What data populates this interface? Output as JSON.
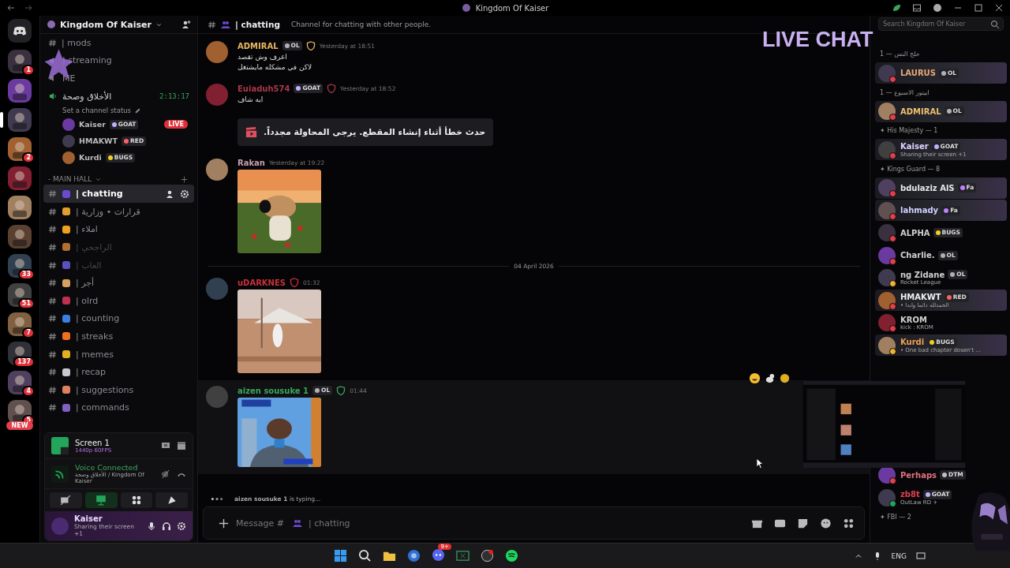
{
  "window": {
    "title": "Kingdom Of Kaiser"
  },
  "servers": [
    {
      "badge": "1",
      "selected": false
    },
    {
      "selected": false
    },
    {
      "selected": true
    },
    {
      "badge": "2",
      "selected": false
    },
    {
      "selected": false
    },
    {
      "selected": false
    },
    {
      "selected": false
    },
    {
      "badge": "33",
      "selected": false
    },
    {
      "badge": "51",
      "selected": false
    },
    {
      "badge": "7",
      "selected": false
    },
    {
      "badge": "137",
      "selected": false
    },
    {
      "badge": "4",
      "selected": false
    },
    {
      "badge": "5",
      "selected": false
    }
  ],
  "new_pill": "NEW",
  "sidebar": {
    "server_name": "Kingdom Of Kaiser",
    "channels_top": [
      {
        "kind": "text",
        "name": "| mods"
      },
      {
        "kind": "voice",
        "name": "| streaming"
      },
      {
        "kind": "voice",
        "name": "ME"
      }
    ],
    "voice_channel": {
      "name": "الأخلاق وصحة",
      "timer": "2:13:17",
      "status": "Set a channel status",
      "users": [
        {
          "name": "Kaiser",
          "tag": "GOAT",
          "badge": "LIVE"
        },
        {
          "name": "HMAKWT",
          "tag": "RED"
        },
        {
          "name": "Kurdi",
          "tag": "BUGS"
        }
      ]
    },
    "category": "- MAIN HALL",
    "channels": [
      {
        "name": "| chatting",
        "color": "#6c4ad0",
        "selected": true,
        "muted": false
      },
      {
        "name": "| قرارات • وزارية",
        "color": "#e0a030",
        "selected": false,
        "muted": false
      },
      {
        "name": "| املاء",
        "color": "#f0a020",
        "selected": false,
        "muted": false
      },
      {
        "name": "| الراجحي",
        "color": "#b07030",
        "selected": false,
        "muted": true
      },
      {
        "name": "| العاب",
        "color": "#5a50c0",
        "selected": false,
        "muted": true
      },
      {
        "name": "| أجر",
        "color": "#d8a060",
        "selected": false,
        "muted": false
      },
      {
        "name": "| olrd",
        "color": "#c03050",
        "selected": false,
        "muted": false
      },
      {
        "name": "| counting",
        "color": "#3a80e0",
        "selected": false,
        "muted": false
      },
      {
        "name": "| streaks",
        "color": "#f07020",
        "selected": false,
        "muted": false
      },
      {
        "name": "| memes",
        "color": "#e0b020",
        "selected": false,
        "muted": false
      },
      {
        "name": "| recap",
        "color": "#c8c8d0",
        "selected": false,
        "muted": false
      },
      {
        "name": "| suggestions",
        "color": "#e08060",
        "selected": false,
        "muted": false
      },
      {
        "name": "| commands",
        "color": "#8060c0",
        "selected": false,
        "muted": false
      }
    ],
    "stream": {
      "title": "Screen 1",
      "quality": "1440p 60FPS"
    },
    "voice": {
      "status": "Voice Connected",
      "location": "الأخلاق وصحة / Kingdom Of Kaiser",
      "screen_share_on": true
    },
    "user": {
      "name": "Kaiser",
      "activity": "Sharing their screen +1"
    }
  },
  "chat": {
    "channel": "| chatting",
    "topic": "Channel for chatting with other people.",
    "messages": [
      {
        "author": "ADMIRAL",
        "color": "#e8b860",
        "tags": [
          "OL"
        ],
        "shield": true,
        "time": "Yesterday at 18:51",
        "lines": [
          "اعرف وش تقصد",
          "لاكن في مشكله مايشتغل"
        ],
        "hovered": false
      },
      {
        "author": "Euiaduh574",
        "color": "#a83848",
        "tags": [
          "GOAT"
        ],
        "shield": true,
        "time": "Yesterday at 18:52",
        "lines": [
          "ايه شاف"
        ],
        "error": "حدث خطأ أثناء إنشاء المقطع. يرجى المحاولة مجدداً.",
        "hovered": false
      },
      {
        "author": "Rakan",
        "color": "#c8a0b0",
        "shield": false,
        "time": "Yesterday at 19:22",
        "attachment": {
          "kind": "picture"
        },
        "hovered": false
      },
      {
        "kind": "divider",
        "label": "04 April 2026"
      },
      {
        "author": "uDARKNES",
        "color": "#c8303a",
        "shield": true,
        "time": "01:32",
        "attachment": {
          "kind": "picture"
        },
        "hovered": false
      },
      {
        "author": "aizen sousuke 1",
        "color": "#3ba55c",
        "tags": [
          "OL"
        ],
        "shield": true,
        "time": "01:44",
        "attachment": {
          "kind": "picture"
        },
        "hovered": true
      }
    ],
    "typing": "**aizen sousuke 1** is typing...",
    "input": {
      "placeholder": "Message #",
      "channel": "| chatting"
    }
  },
  "members": {
    "search_placeholder": "Search Kingdom Of Kaiser",
    "groups": [
      {
        "label": "حلج النس — 1",
        "members": [
          {
            "name": {
              "text": "LAURUS",
              "color": "#e8a878"
            },
            "tags": [
              "OL"
            ],
            "status": {
              "color": "#e0404a"
            },
            "banner": true
          }
        ]
      },
      {
        "label": "ابيتور الاسبوع — 1",
        "members": [
          {
            "name": {
              "text": "ADMIRAL",
              "color": "#f0c070"
            },
            "tags": [
              "OL"
            ],
            "status": {
              "color": "#e0404a"
            },
            "banner": true
          }
        ]
      },
      {
        "label": "✦ His Majesty — 1",
        "members": [
          {
            "name": {
              "text": "Kaiser",
              "color": "#e0d0ff"
            },
            "tags": [
              "GOAT"
            ],
            "activity": "Sharing their screen +1",
            "status": {
              "color": "#e0404a"
            },
            "banner": true
          }
        ]
      },
      {
        "label": "✦ Kings Guard — 8",
        "members": [
          {
            "name": {
              "text": "bdulaziz AlS",
              "color": "#e8e8e8"
            },
            "tags": [
              "Fa"
            ],
            "status": {
              "color": "#e0404a"
            },
            "banner": true
          },
          {
            "name": {
              "text": "lahmady",
              "color": "#d0d0ff"
            },
            "tags": [
              "Fa"
            ],
            "status": {
              "color": "#e0404a"
            },
            "banner": true
          },
          {
            "name": {
              "text": "ALPHA",
              "color": "#d0d0d0"
            },
            "tags": [
              "BUGS"
            ],
            "status": {
              "color": "#e0404a"
            },
            "banner": false
          },
          {
            "name": {
              "text": "Charlie.",
              "color": "#d0d0d0"
            },
            "tags": [
              "OL"
            ],
            "status": {
              "color": "#e0404a"
            },
            "banner": false
          },
          {
            "name": {
              "text": "ng Zidane",
              "color": "#d0d0d0"
            },
            "tags": [
              "OL"
            ],
            "activity": "Rocket League",
            "status": {
              "color": "#f0b232"
            },
            "banner": false
          },
          {
            "name": {
              "text": "HMAKWT",
              "color": "#f0f0f0"
            },
            "tags": [
              "RED"
            ],
            "activity": "• الحمدلله دائما وابدا",
            "status": {
              "color": "#e0404a"
            },
            "banner": true
          },
          {
            "name": {
              "text": "KROM",
              "color": "#d0d0d0"
            },
            "activity": "kick : KROM",
            "status": {
              "color": "#e0404a"
            },
            "banner": false
          },
          {
            "name": {
              "text": "Kurdi",
              "color": "#f0a050"
            },
            "tags": [
              "BUGS"
            ],
            "activity": "• One bad chapter dosen't ...",
            "status": {
              "color": "#f0b232"
            },
            "banner": true
          }
        ]
      },
      {
        "members": [
          {
            "name": {
              "text": "Perhaps",
              "color": "#e07080"
            },
            "tags": [
              "DTM"
            ],
            "status": {
              "color": "#e0404a"
            },
            "banner": false
          },
          {
            "name": {
              "text": "zb8t",
              "color": "#e04050"
            },
            "tags": [
              "GOAT"
            ],
            "activity": "OutLaw RD +",
            "status": {
              "color": "#23a55a"
            },
            "banner": false
          }
        ]
      },
      {
        "label": "✦ FBI — 2"
      }
    ]
  },
  "overlay": {
    "live_chat": "LIVE CHAT"
  },
  "taskbar": {
    "discord_badge": "9+",
    "language": "ENG"
  }
}
